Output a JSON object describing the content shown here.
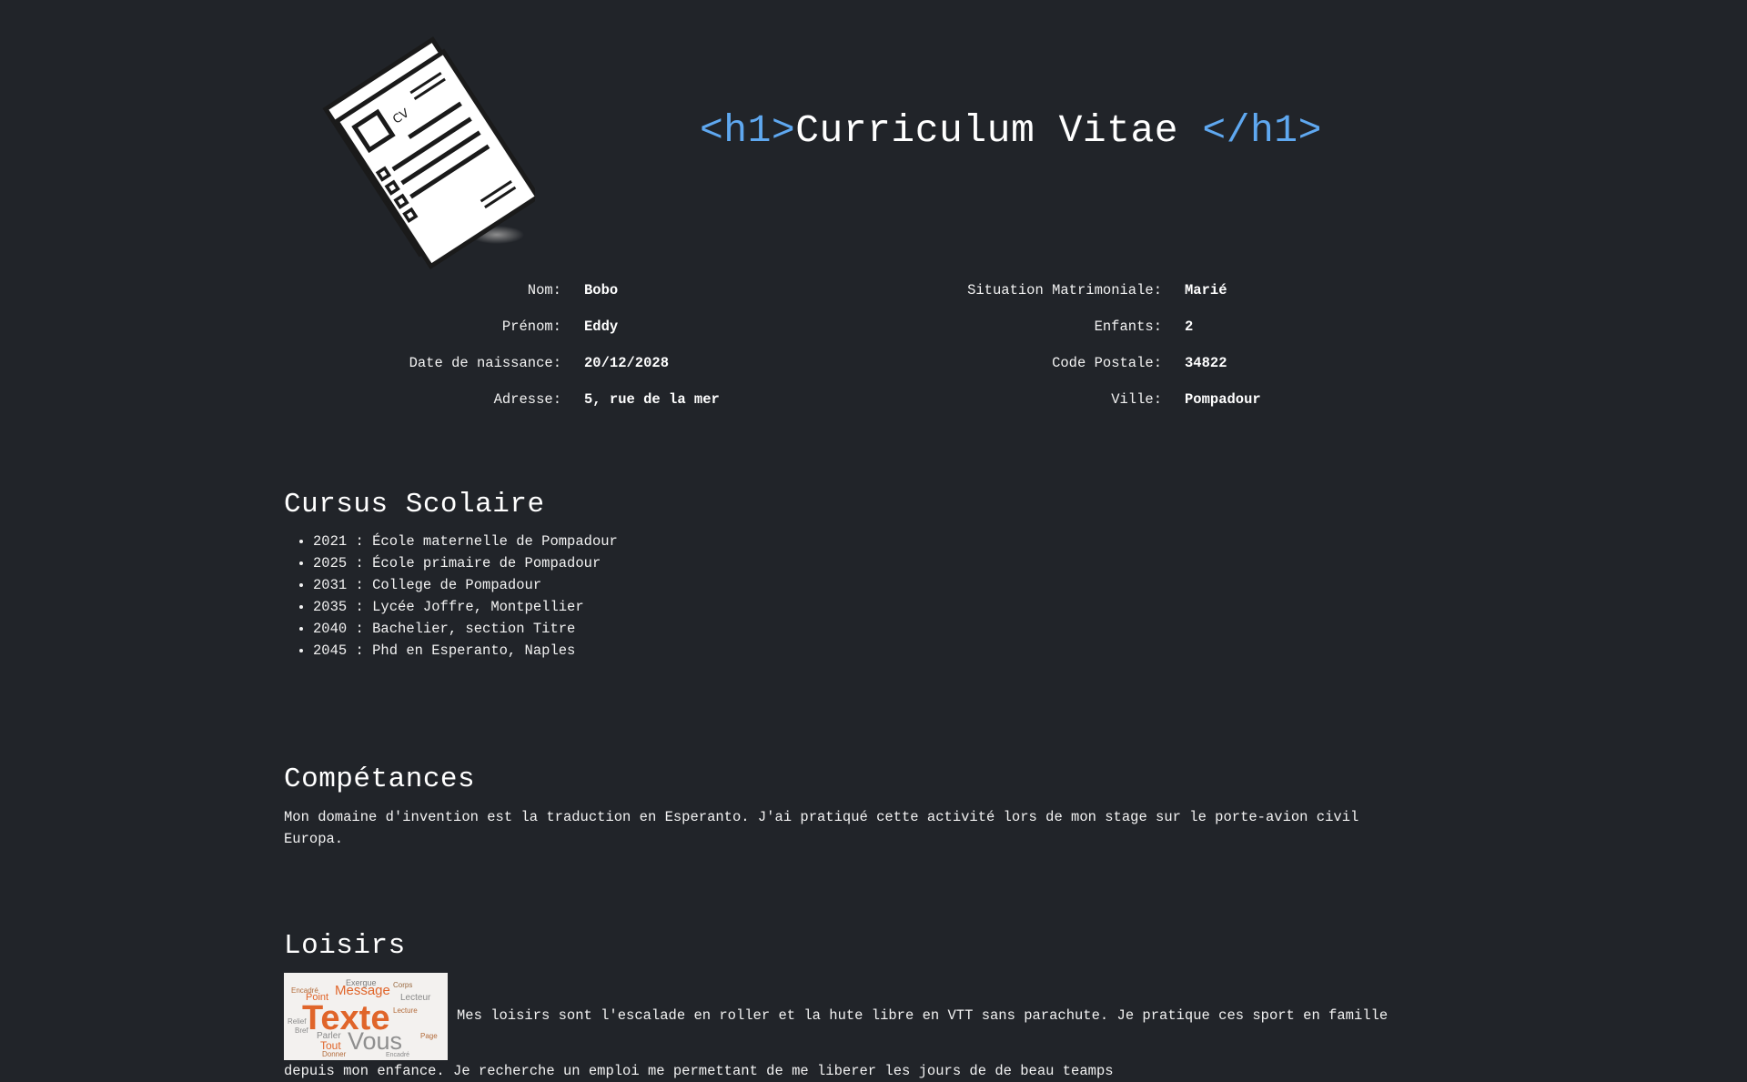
{
  "header": {
    "tag_open": "<h1>",
    "title": "Curriculum Vitae ",
    "tag_close": "</h1>",
    "logo_text": "CV"
  },
  "info": {
    "left": [
      {
        "label": "Nom:",
        "value": "Bobo"
      },
      {
        "label": "Prénom:",
        "value": "Eddy"
      },
      {
        "label": "Date de naissance:",
        "value": "20/12/2028"
      },
      {
        "label": "Adresse:",
        "value": "5, rue de la mer"
      }
    ],
    "right": [
      {
        "label": "Situation Matrimoniale:",
        "value": "Marié"
      },
      {
        "label": "Enfants:",
        "value": "2"
      },
      {
        "label": "Code Postale:",
        "value": "34822"
      },
      {
        "label": "Ville:",
        "value": "Pompadour"
      }
    ]
  },
  "cursus": {
    "title": "Cursus Scolaire",
    "items": [
      "2021 : École maternelle de Pompadour",
      "2025 : École primaire de Pompadour",
      "2031 : College de Pompadour",
      "2035 : Lycée Joffre, Montpellier",
      "2040 : Bachelier, section Titre",
      "2045 : Phd en Esperanto, Naples"
    ]
  },
  "competences": {
    "title": "Compétances",
    "line1": "Mon domaine d'invention est la traduction en Esperanto. J'ai pratiqué cette activité lors de mon stage sur le porte-avion civil",
    "line2": "Europa."
  },
  "loisirs": {
    "title": "Loisirs",
    "image_words": [
      "Texte",
      "Vous",
      "Message",
      "Point",
      "Lecteur",
      "Tout",
      "Parler",
      "Donner",
      "Exergue",
      "Relief",
      "Lecture",
      "Encadré",
      "Page",
      "Bref",
      "Corps"
    ],
    "line1": "Mes loisirs sont l'escalade en roller et la hute libre en VTT sans parachute. Je pratique ces sport en famille",
    "line2": "depuis mon enfance. Je recherche un emploi me permettant de me liberer les jours de de beau teamps"
  },
  "colors": {
    "background": "#212429",
    "tag_blue": "#5fa8f0",
    "text": "#ffffff",
    "wordcloud_orange": "#e0652a"
  }
}
